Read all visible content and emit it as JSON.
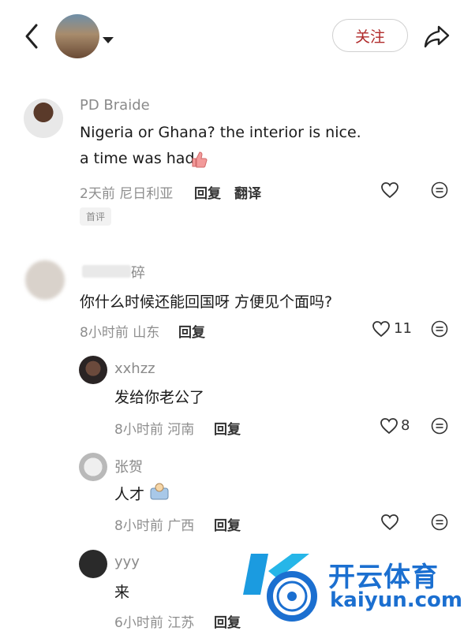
{
  "header": {
    "follow_label": "关注"
  },
  "comments": [
    {
      "author": "PD Braide",
      "lines": [
        "Nigeria or Ghana? the interior is nice.",
        "a time was had"
      ],
      "time_location": "2天前 尼日利亚",
      "reply_label": "回复",
      "translate_label": "翻译",
      "badge": "首评"
    },
    {
      "author": "碎",
      "text": "你什么时候还能回国呀 方便见个面吗?",
      "time_location": "8小时前 山东",
      "reply_label": "回复",
      "likes": "11"
    }
  ],
  "replies": [
    {
      "author": "xxhzz",
      "text": "发给你老公了",
      "time_location": "8小时前 河南",
      "reply_label": "回复",
      "likes": "8"
    },
    {
      "author": "张贺",
      "text": "人才",
      "time_location": "8小时前 广西",
      "reply_label": "回复"
    },
    {
      "author": "yyy",
      "text": "来",
      "time_location": "6小时前 江苏",
      "reply_label": "回复"
    }
  ],
  "watermark": {
    "brand": "开云体育",
    "url": "kaiyun.com"
  },
  "icons": [
    "back-icon",
    "share-icon",
    "heart-icon",
    "more-icon",
    "emoji-icon"
  ]
}
